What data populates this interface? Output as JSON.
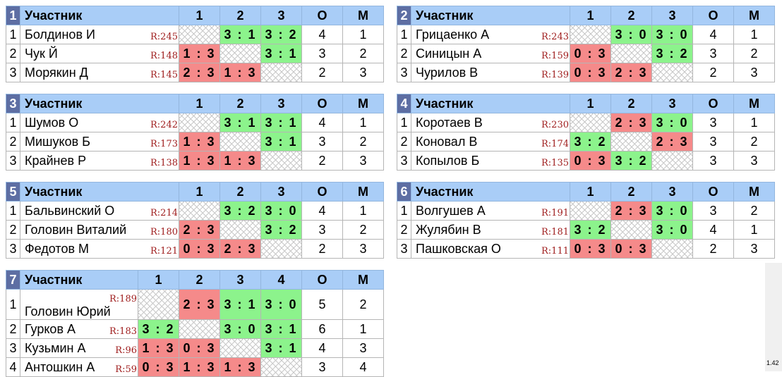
{
  "header_label": "Участник",
  "points_label": "О",
  "place_label": "М",
  "version": "1.42",
  "groups": [
    {
      "num": "1",
      "cols": [
        "1",
        "2",
        "3"
      ],
      "rows": [
        {
          "n": "1",
          "name": "Болдинов И",
          "rating": "R:245",
          "cells": [
            [
              "",
              ""
            ],
            [
              "3 : 1",
              "w"
            ],
            [
              "3 : 2",
              "w"
            ]
          ],
          "points": "4",
          "place": "1"
        },
        {
          "n": "2",
          "name": "Чук Й",
          "rating": "R:148",
          "cells": [
            [
              "1 : 3",
              "l"
            ],
            [
              "",
              ""
            ],
            [
              "3 : 1",
              "w"
            ]
          ],
          "points": "3",
          "place": "2"
        },
        {
          "n": "3",
          "name": "Морякин Д",
          "rating": "R:145",
          "cells": [
            [
              "2 : 3",
              "l"
            ],
            [
              "1 : 3",
              "l"
            ],
            [
              "",
              ""
            ]
          ],
          "points": "2",
          "place": "3"
        }
      ]
    },
    {
      "num": "2",
      "cols": [
        "1",
        "2",
        "3"
      ],
      "rows": [
        {
          "n": "1",
          "name": "Грицаенко А",
          "rating": "R:243",
          "cells": [
            [
              "",
              ""
            ],
            [
              "3 : 0",
              "w"
            ],
            [
              "3 : 0",
              "w"
            ]
          ],
          "points": "4",
          "place": "1"
        },
        {
          "n": "2",
          "name": "Синицын А",
          "rating": "R:159",
          "cells": [
            [
              "0 : 3",
              "l"
            ],
            [
              "",
              ""
            ],
            [
              "3 : 2",
              "w"
            ]
          ],
          "points": "3",
          "place": "2"
        },
        {
          "n": "3",
          "name": "Чурилов В",
          "rating": "R:139",
          "cells": [
            [
              "0 : 3",
              "l"
            ],
            [
              "2 : 3",
              "l"
            ],
            [
              "",
              ""
            ]
          ],
          "points": "2",
          "place": "3"
        }
      ]
    },
    {
      "num": "3",
      "cols": [
        "1",
        "2",
        "3"
      ],
      "rows": [
        {
          "n": "1",
          "name": "Шумов О",
          "rating": "R:242",
          "cells": [
            [
              "",
              ""
            ],
            [
              "3 : 1",
              "w"
            ],
            [
              "3 : 1",
              "w"
            ]
          ],
          "points": "4",
          "place": "1"
        },
        {
          "n": "2",
          "name": "Мишуков Б",
          "rating": "R:173",
          "cells": [
            [
              "1 : 3",
              "l"
            ],
            [
              "",
              ""
            ],
            [
              "3 : 1",
              "w"
            ]
          ],
          "points": "3",
          "place": "2"
        },
        {
          "n": "3",
          "name": "Крайнев Р",
          "rating": "R:138",
          "cells": [
            [
              "1 : 3",
              "l"
            ],
            [
              "1 : 3",
              "l"
            ],
            [
              "",
              ""
            ]
          ],
          "points": "2",
          "place": "3"
        }
      ]
    },
    {
      "num": "4",
      "cols": [
        "1",
        "2",
        "3"
      ],
      "rows": [
        {
          "n": "1",
          "name": "Коротаев В",
          "rating": "R:230",
          "cells": [
            [
              "",
              ""
            ],
            [
              "2 : 3",
              "l"
            ],
            [
              "3 : 0",
              "w"
            ]
          ],
          "points": "3",
          "place": "1"
        },
        {
          "n": "2",
          "name": "Коновал В",
          "rating": "R:174",
          "cells": [
            [
              "3 : 2",
              "w"
            ],
            [
              "",
              ""
            ],
            [
              "2 : 3",
              "l"
            ]
          ],
          "points": "3",
          "place": "2"
        },
        {
          "n": "3",
          "name": "Копылов Б",
          "rating": "R:135",
          "cells": [
            [
              "0 : 3",
              "l"
            ],
            [
              "3 : 2",
              "w"
            ],
            [
              "",
              ""
            ]
          ],
          "points": "3",
          "place": "3"
        }
      ]
    },
    {
      "num": "5",
      "cols": [
        "1",
        "2",
        "3"
      ],
      "rows": [
        {
          "n": "1",
          "name": "Бальвинский О",
          "rating": "R:214",
          "cells": [
            [
              "",
              ""
            ],
            [
              "3 : 2",
              "w"
            ],
            [
              "3 : 0",
              "w"
            ]
          ],
          "points": "4",
          "place": "1"
        },
        {
          "n": "2",
          "name": "Головин Виталий",
          "rating": "R:180",
          "cells": [
            [
              "2 : 3",
              "l"
            ],
            [
              "",
              ""
            ],
            [
              "3 : 2",
              "w"
            ]
          ],
          "points": "3",
          "place": "2"
        },
        {
          "n": "3",
          "name": "Федотов М",
          "rating": "R:121",
          "cells": [
            [
              "0 : 3",
              "l"
            ],
            [
              "2 : 3",
              "l"
            ],
            [
              "",
              ""
            ]
          ],
          "points": "2",
          "place": "3"
        }
      ]
    },
    {
      "num": "6",
      "cols": [
        "1",
        "2",
        "3"
      ],
      "rows": [
        {
          "n": "1",
          "name": "Волгушев А",
          "rating": "R:191",
          "cells": [
            [
              "",
              ""
            ],
            [
              "2 : 3",
              "l"
            ],
            [
              "3 : 0",
              "w"
            ]
          ],
          "points": "3",
          "place": "2"
        },
        {
          "n": "2",
          "name": "Жулябин В",
          "rating": "R:181",
          "cells": [
            [
              "3 : 2",
              "w"
            ],
            [
              "",
              ""
            ],
            [
              "3 : 0",
              "w"
            ]
          ],
          "points": "4",
          "place": "1"
        },
        {
          "n": "3",
          "name": "Пашковская О",
          "rating": "R:111",
          "cells": [
            [
              "0 : 3",
              "l"
            ],
            [
              "0 : 3",
              "l"
            ],
            [
              "",
              ""
            ]
          ],
          "points": "2",
          "place": "3"
        }
      ]
    },
    {
      "num": "7",
      "cols": [
        "1",
        "2",
        "3",
        "4"
      ],
      "rows": [
        {
          "n": "1",
          "name": "Головин Юрий",
          "rating": "R:189",
          "cells": [
            [
              "",
              ""
            ],
            [
              "2 : 3",
              "l"
            ],
            [
              "3 : 1",
              "w"
            ],
            [
              "3 : 0",
              "w"
            ]
          ],
          "points": "5",
          "place": "2"
        },
        {
          "n": "2",
          "name": "Гурков А",
          "rating": "R:183",
          "cells": [
            [
              "3 : 2",
              "w"
            ],
            [
              "",
              ""
            ],
            [
              "3 : 0",
              "w"
            ],
            [
              "3 : 1",
              "w"
            ]
          ],
          "points": "6",
          "place": "1"
        },
        {
          "n": "3",
          "name": "Кузьмин А",
          "rating": "R:96",
          "cells": [
            [
              "1 : 3",
              "l"
            ],
            [
              "0 : 3",
              "l"
            ],
            [
              "",
              ""
            ],
            [
              "3 : 1",
              "w"
            ]
          ],
          "points": "4",
          "place": "3"
        },
        {
          "n": "4",
          "name": "Антошкин А",
          "rating": "R:59",
          "cells": [
            [
              "0 : 3",
              "l"
            ],
            [
              "1 : 3",
              "l"
            ],
            [
              "1 : 3",
              "l"
            ],
            [
              "",
              ""
            ]
          ],
          "points": "3",
          "place": "4"
        }
      ]
    }
  ]
}
